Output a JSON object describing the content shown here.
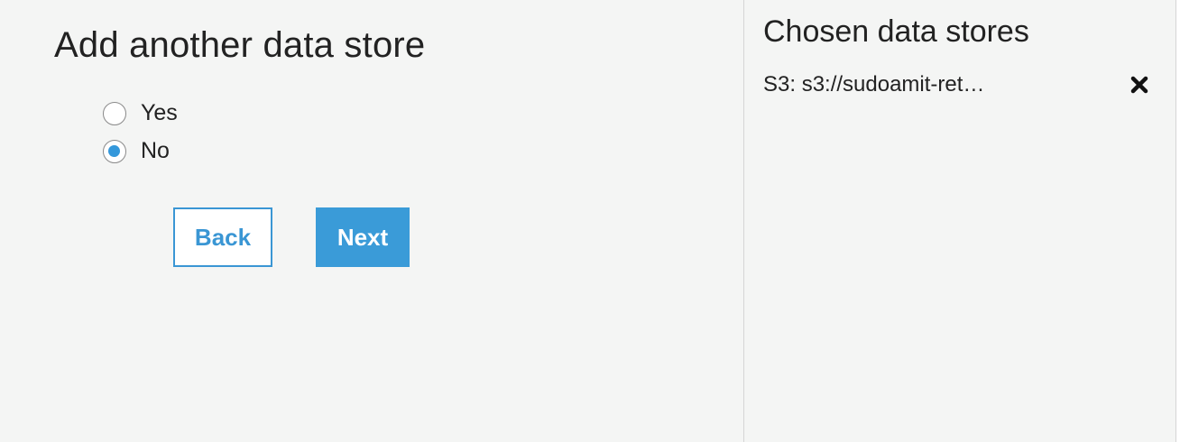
{
  "main": {
    "title": "Add another data store",
    "options": [
      {
        "label": "Yes",
        "checked": false
      },
      {
        "label": "No",
        "checked": true
      }
    ],
    "back_label": "Back",
    "next_label": "Next"
  },
  "sidebar": {
    "title": "Chosen data stores",
    "items": [
      {
        "label": "S3: s3://sudoamit-ret…",
        "remove_icon": "close-icon"
      }
    ]
  },
  "colors": {
    "accent": "#3a9bd8",
    "background": "#f4f5f4"
  }
}
